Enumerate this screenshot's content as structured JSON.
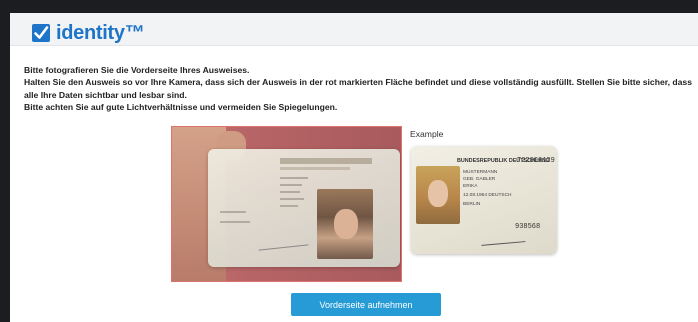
{
  "header": {
    "brand": "identity™"
  },
  "instructions": [
    "Bitte fotografieren Sie die Vorderseite Ihres Ausweises.",
    "Halten Sie den Ausweis so vor Ihre Kamera, dass sich der Ausweis in der rot markierten Fläche befindet und diese vollständig ausfüllt. Stellen Sie bitte sicher, dass alle Ihre Daten sichtbar und lesbar sind.",
    "Bitte achten Sie auf gute Lichtverhältnisse und vermeiden Sie Spiegelungen."
  ],
  "example": {
    "label": "Example",
    "card": {
      "title": "BUNDESREPUBLIK DEUTSCHLAND",
      "number": "T22000129",
      "lines": [
        "MUSTERMANN",
        "GEB. GABLER",
        "ERIKA",
        "12.08.1964  DEUTSCH",
        "BERLIN"
      ],
      "code": "938568"
    }
  },
  "capture_button": {
    "label": "Vorderseite aufnehmen"
  },
  "colors": {
    "brand": "#1e74c8",
    "button": "#279bd6",
    "camera_border": "#e0736e"
  }
}
